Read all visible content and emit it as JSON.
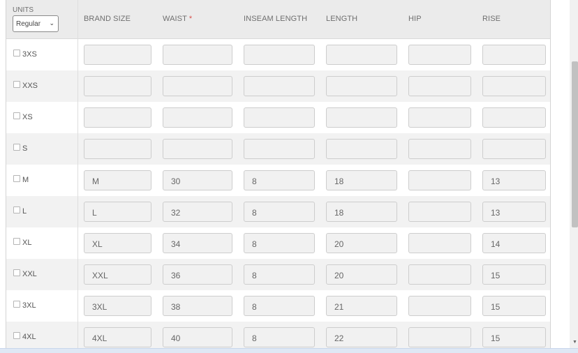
{
  "units": {
    "label": "UNITS",
    "selected": "Regular"
  },
  "columns": [
    {
      "key": "brand_size",
      "label": "BRAND SIZE",
      "required": false
    },
    {
      "key": "waist",
      "label": "WAIST",
      "required": true
    },
    {
      "key": "inseam",
      "label": "INSEAM LENGTH",
      "required": false
    },
    {
      "key": "length",
      "label": "LENGTH",
      "required": false
    },
    {
      "key": "hip",
      "label": "HIP",
      "required": false
    },
    {
      "key": "rise",
      "label": "RISE",
      "required": false
    }
  ],
  "required_marker": "*",
  "rows": [
    {
      "size": "3XS",
      "values": [
        "",
        "",
        "",
        "",
        "",
        ""
      ]
    },
    {
      "size": "XXS",
      "values": [
        "",
        "",
        "",
        "",
        "",
        ""
      ]
    },
    {
      "size": "XS",
      "values": [
        "",
        "",
        "",
        "",
        "",
        ""
      ]
    },
    {
      "size": "S",
      "values": [
        "",
        "",
        "",
        "",
        "",
        ""
      ]
    },
    {
      "size": "M",
      "values": [
        "M",
        "30",
        "8",
        "18",
        "",
        "13"
      ]
    },
    {
      "size": "L",
      "values": [
        "L",
        "32",
        "8",
        "18",
        "",
        "13"
      ]
    },
    {
      "size": "XL",
      "values": [
        "XL",
        "34",
        "8",
        "20",
        "",
        "14"
      ]
    },
    {
      "size": "XXL",
      "values": [
        "XXL",
        "36",
        "8",
        "20",
        "",
        "15"
      ]
    },
    {
      "size": "3XL",
      "values": [
        "3XL",
        "38",
        "8",
        "21",
        "",
        "15"
      ]
    },
    {
      "size": "4XL",
      "values": [
        "4XL",
        "40",
        "8",
        "22",
        "",
        "15"
      ]
    }
  ],
  "icons": {
    "select": "chevron-down-icon",
    "checkbox": "checkbox-icon",
    "scroll": "scroll-down-arrow-icon"
  }
}
